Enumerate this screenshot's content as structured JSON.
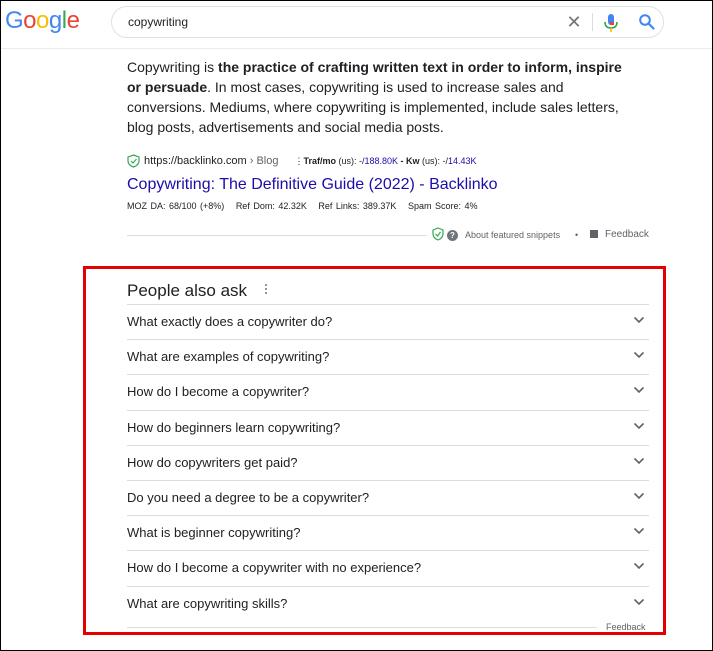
{
  "header": {
    "logo_letters": [
      {
        "ch": "G",
        "color": "#4285F4"
      },
      {
        "ch": "o",
        "color": "#EA4335"
      },
      {
        "ch": "o",
        "color": "#FBBC05"
      },
      {
        "ch": "g",
        "color": "#4285F4"
      },
      {
        "ch": "l",
        "color": "#34A853"
      },
      {
        "ch": "e",
        "color": "#EA4335"
      }
    ],
    "query": "copywriting",
    "icons": [
      "clear-icon",
      "mic-icon",
      "search-icon"
    ]
  },
  "snippet": {
    "lead": "Copywriting is ",
    "bold": "the practice of crafting written text in order to inform, inspire or persuade",
    "rest": ". In most cases, copywriting is used to increase sales and conversions. Mediums, where copywriting is implemented, include sales letters, blog posts, advertisements and social media posts.",
    "url": "https://backlinko.com",
    "crumb": "› Blog",
    "seo_label_1": "Traf/mo",
    "seo_mid_1": " (us): -/",
    "seo_val_1": "188.80K",
    "seo_label_2": " - Kw",
    "seo_mid_2": " (us): -/",
    "seo_val_2": "14.43K",
    "title": "Copywriting: The Definitive Guide (2022) - Backlinko",
    "moz": [
      "MOZ DA: 68/100 (+8%)",
      "Ref Dom: 42.32K",
      "Ref Links: 389.37K",
      "Spam Score: 4%"
    ],
    "about": "About featured snippets",
    "dot": "•",
    "feedback": "Feedback",
    "shield_color": "#34A853"
  },
  "paa": {
    "title": "People also ask",
    "questions": [
      "What exactly does a copywriter do?",
      "What are examples of copywriting?",
      "How do I become a copywriter?",
      "How do beginners learn copywriting?",
      "How do copywriters get paid?",
      "Do you need a degree to be a copywriter?",
      "What is beginner copywriting?",
      "How do I become a copywriter with no experience?",
      "What are copywriting skills?"
    ],
    "feedback": "Feedback",
    "highlight_color": "#E50000"
  }
}
